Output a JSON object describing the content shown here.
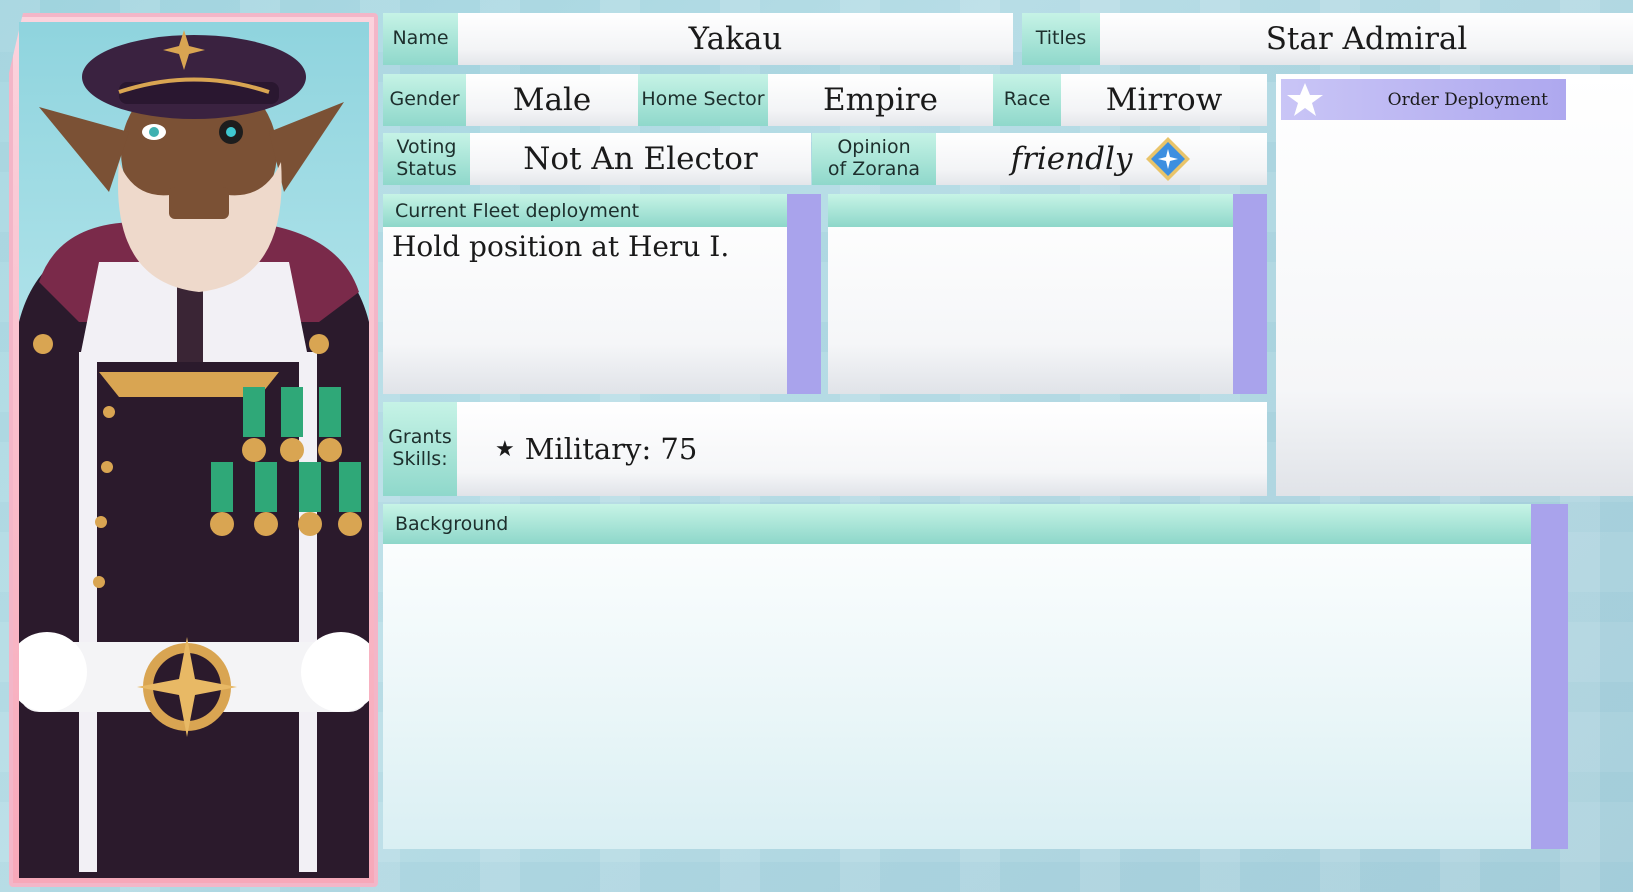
{
  "name": {
    "label": "Name",
    "value": "Yakau"
  },
  "titles": {
    "label": "Titles",
    "value": "Star Admiral"
  },
  "gender": {
    "label": "Gender",
    "value": "Male"
  },
  "home_sector": {
    "label": "Home Sector",
    "value": "Empire"
  },
  "race": {
    "label": "Race",
    "value": "Mirrow"
  },
  "voting": {
    "label_line1": "Voting",
    "label_line2": "Status",
    "value": "Not An Elector"
  },
  "opinion": {
    "label_line1": "Opinion",
    "label_line2": "of Zorana",
    "value": "friendly",
    "icon": "diamond-star-icon"
  },
  "fleet": {
    "header": "Current Fleet deployment",
    "text": "Hold position at Heru I.",
    "second_header": ""
  },
  "skills": {
    "label_line1": "Grants",
    "label_line2": "Skills:",
    "items": [
      {
        "icon": "star-icon",
        "text": "Military: 75"
      }
    ]
  },
  "actions": {
    "order_deployment": "Order Deployment"
  },
  "background": {
    "header": "Background",
    "text": ""
  },
  "colors": {
    "teal": "#8fd8cb",
    "scroll": "#a9a3ec",
    "accent_purple": "#b8b2f2",
    "frame_pink": "#f3b6c8"
  }
}
